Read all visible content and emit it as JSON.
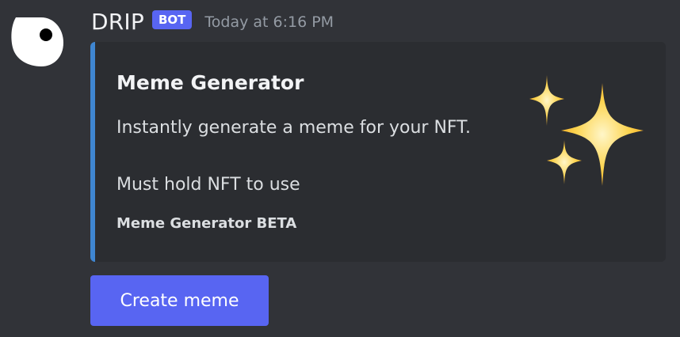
{
  "message": {
    "username": "DRIP",
    "badge": "BOT",
    "timestamp": "Today at 6:16 PM",
    "avatar_icon": "drip-logo-icon"
  },
  "embed": {
    "accent_color": "#3f86d1",
    "title": "Meme Generator",
    "description": "Instantly generate a meme for your NFT.",
    "field_value": "Must hold NFT to use",
    "footer": "Meme Generator BETA",
    "thumbnail_icon": "sparkles-icon"
  },
  "actions": {
    "create_label": "Create meme",
    "button_color": "#5865f2"
  }
}
